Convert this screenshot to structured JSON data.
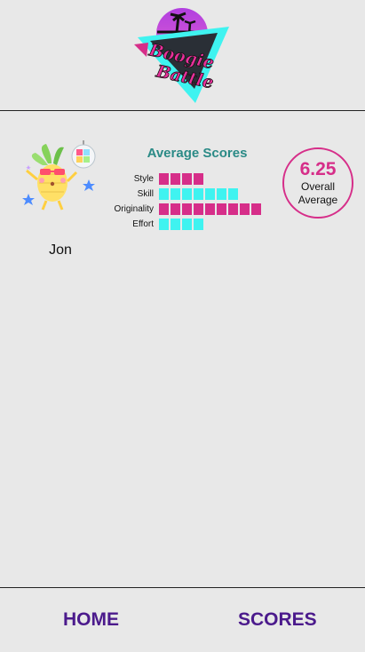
{
  "logo": {
    "text_line1": "Boogie",
    "text_line2": "Battle"
  },
  "player": {
    "name": "Jon"
  },
  "scores": {
    "title": "Average Scores",
    "rows": [
      {
        "label": "Style",
        "value": 4,
        "color": "#d62e89"
      },
      {
        "label": "Skill",
        "value": 7,
        "color": "#3ff3f0"
      },
      {
        "label": "Originality",
        "value": 9,
        "color": "#d62e89"
      },
      {
        "label": "Effort",
        "value": 4,
        "color": "#3ff3f0"
      }
    ]
  },
  "overall": {
    "value": "6.25",
    "label_line1": "Overall",
    "label_line2": "Average"
  },
  "nav": {
    "home": "HOME",
    "scores": "SCORES"
  },
  "colors": {
    "accent_pink": "#d62e89",
    "accent_cyan": "#3ff3f0",
    "teal_title": "#2a8a86",
    "nav_purple": "#4b1a8c",
    "background": "#e8e8e8"
  }
}
